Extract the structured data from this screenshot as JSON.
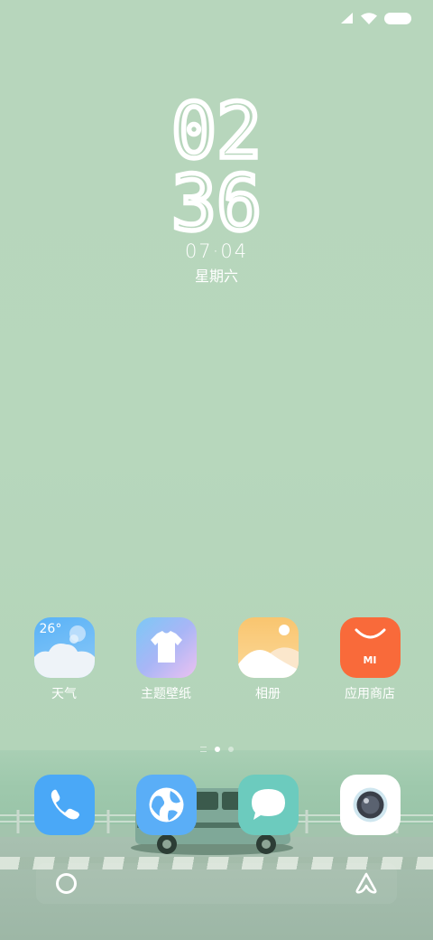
{
  "clock": {
    "hour": "02",
    "minute": "36",
    "date": "07·04",
    "weekday": "星期六"
  },
  "status_bar": {
    "icons": [
      "signal-icon",
      "wifi-icon",
      "battery-icon"
    ]
  },
  "apps": [
    {
      "label": "天气",
      "icon": "weather-icon",
      "badge_text": "26°",
      "color": "#62b4f5"
    },
    {
      "label": "主题壁纸",
      "icon": "theme-shirt-icon",
      "color": "#9fb6f7"
    },
    {
      "label": "相册",
      "icon": "gallery-icon",
      "color": "#f9c97a"
    },
    {
      "label": "应用商店",
      "icon": "app-store-icon",
      "logo_text": "MI",
      "color": "#f96a3a"
    }
  ],
  "page_indicator": {
    "pages": 2,
    "active_page": 1
  },
  "dock": [
    {
      "icon": "phone-icon",
      "color": "#4aa8f7"
    },
    {
      "icon": "browser-globe-icon",
      "color": "#59acf7"
    },
    {
      "icon": "messages-icon",
      "color": "#6ccbbe"
    },
    {
      "icon": "camera-icon",
      "color": "#ffffff"
    }
  ],
  "nav_bar": {
    "icons": [
      "home-circle-icon",
      "assistant-icon"
    ]
  }
}
